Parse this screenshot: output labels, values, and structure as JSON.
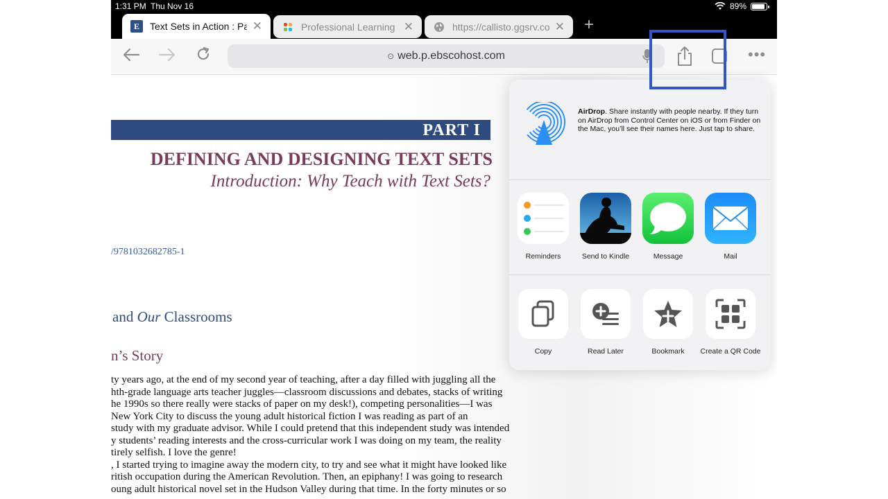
{
  "status_bar": {
    "time": "1:31 PM",
    "date": "Thu Nov 16",
    "battery": "89%",
    "battery_level": 0.89
  },
  "tabs": [
    {
      "title": "Text Sets in Action : Path",
      "favicon": "ebsco-logo-icon",
      "favicon_text": "E",
      "active": true
    },
    {
      "title": "Professional Learning eB",
      "favicon": "joomla-icon",
      "active": false
    },
    {
      "title": "https://callisto.ggsrv.com",
      "favicon": "globe-icon",
      "active": false
    }
  ],
  "toolbar": {
    "url": "web.p.ebscohost.com"
  },
  "document": {
    "part_label": "PART I",
    "title": "DEFINING AND DESIGNING TEXT SETS",
    "subtitle": "Introduction: Why Teach with Text Sets?",
    "doi_fragment": "/9781032682785-1",
    "section_part1": "and ",
    "section_em": "Our",
    "section_part2": " Classrooms",
    "subsection": "n’s Story",
    "body_lines": [
      "ty years ago, at the end of my second year of teaching, after a day filled with juggling all the",
      "hth-grade language arts teacher juggles—classroom discussions and debates, stacks of writing",
      "he 1990s so there really were stacks of paper on my desk!), competing personalities—I was",
      "New York City to discuss the young adult historical fiction I was reading as part of an",
      "study with my graduate advisor. While I could pretend that this independent study was intended",
      "y students’ reading interests and the cross-curricular work I was doing on my team, the reality",
      "tirely selfish. I love the genre!",
      ", I started trying to imagine away the modern city, to try and see what it might have looked like",
      "ritish occupation during the American Revolution. Then, an epiphany! I was going to research",
      "oung adult historical novel set in the Hudson Valley during that time. In the forty minutes or so"
    ]
  },
  "share_sheet": {
    "airdrop_title": "AirDrop",
    "airdrop_text": ". Share instantly with people nearby. If they turn on AirDrop from Control Center on iOS or from Finder on the Mac, you’ll see their names here. Just tap to share.",
    "apps": [
      {
        "label": "Reminders",
        "icon": "reminders-icon"
      },
      {
        "label": "Send to Kindle",
        "icon": "kindle-icon"
      },
      {
        "label": "Message",
        "icon": "messages-icon"
      },
      {
        "label": "Mail",
        "icon": "mail-icon"
      }
    ],
    "actions": [
      {
        "label": "Copy",
        "icon": "copy-icon"
      },
      {
        "label": "Read Later",
        "icon": "read-later-icon"
      },
      {
        "label": "Bookmark",
        "icon": "bookmark-star-icon"
      },
      {
        "label": "Create a QR Code",
        "icon": "qr-code-icon"
      }
    ]
  },
  "colors": {
    "accent_blue": "#2f58c6",
    "part_bar": "#2e4a7e",
    "title_plum": "#7a3a5a"
  }
}
